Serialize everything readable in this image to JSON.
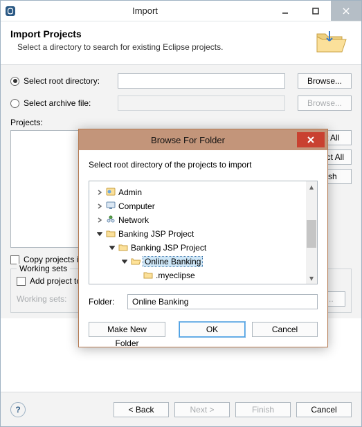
{
  "import": {
    "title": "Import",
    "header_title": "Import Projects",
    "header_desc": "Select a directory to search for existing Eclipse projects.",
    "root_dir_label": "Select root directory:",
    "archive_label": "Select archive file:",
    "browse": "Browse...",
    "projects_label": "Projects:",
    "select_all": "Select All",
    "deselect_all": "Deselect All",
    "refresh": "Refresh",
    "copy_projects": "Copy projects into workspace",
    "working_sets_group": "Working sets",
    "add_project": "Add project to working sets",
    "working_sets_label": "Working sets:",
    "select_ws": "Select...",
    "back": "< Back",
    "next": "Next >",
    "finish": "Finish",
    "cancel": "Cancel"
  },
  "browse": {
    "title": "Browse For Folder",
    "instruction": "Select root directory of the projects to import",
    "tree": {
      "admin": "Admin",
      "computer": "Computer",
      "network": "Network",
      "bjsp1": "Banking JSP Project",
      "bjsp2": "Banking JSP Project",
      "online_banking": "Online Banking",
      "myeclipse": ".myeclipse"
    },
    "folder_label": "Folder:",
    "folder_value": "Online Banking",
    "make_new": "Make New Folder",
    "ok": "OK",
    "cancel": "Cancel"
  }
}
